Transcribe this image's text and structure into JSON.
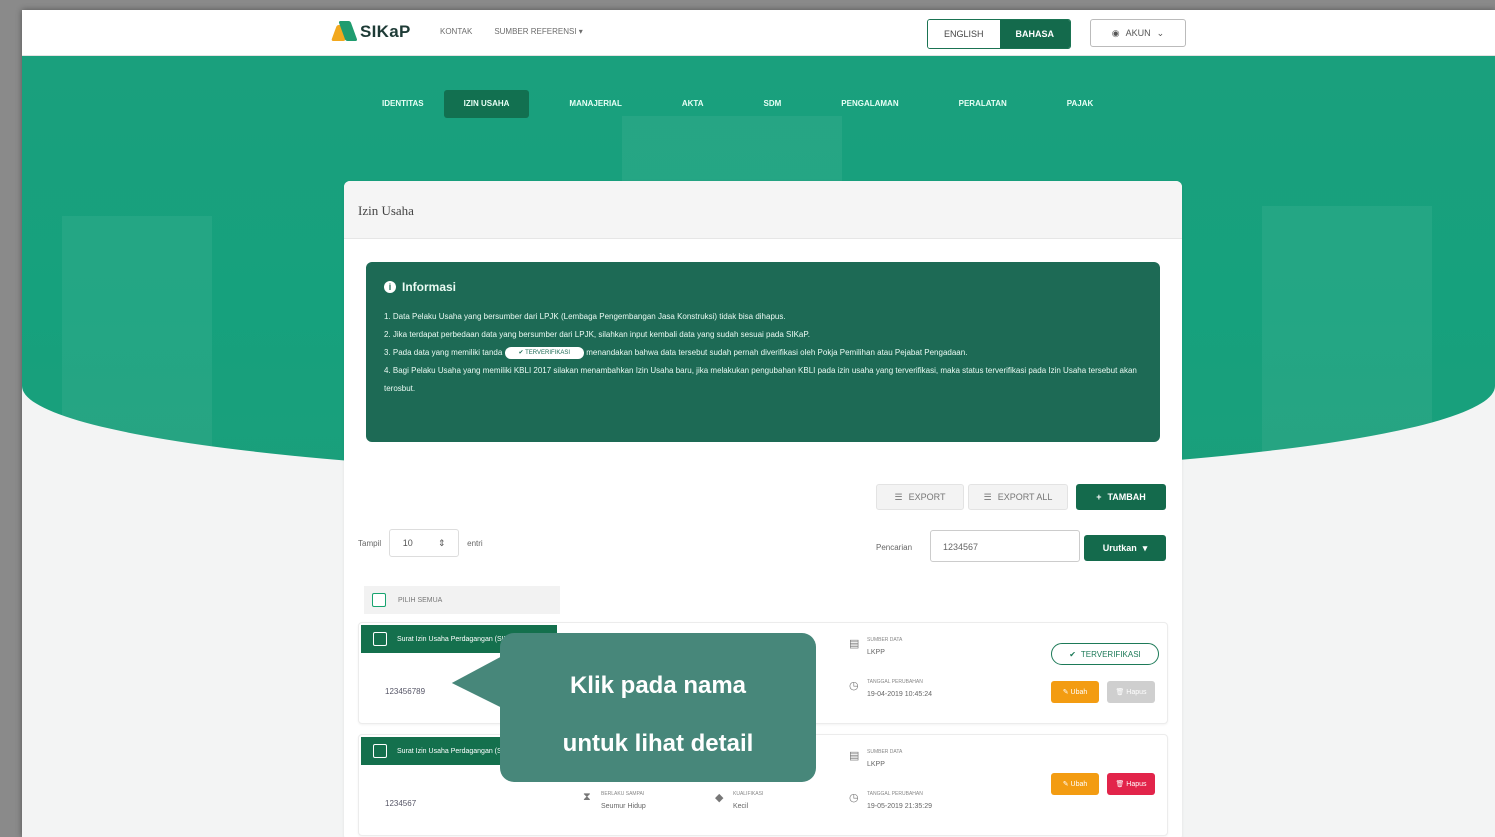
{
  "header": {
    "logo_text": "SIKaP",
    "nav": [
      "KONTAK",
      "SUMBER REFERENSI"
    ],
    "lang_en": "ENGLISH",
    "lang_id": "BAHASA",
    "akun": "AKUN"
  },
  "tabs": [
    "IDENTITAS",
    "IZIN USAHA",
    "MANAJERIAL",
    "AKTA",
    "SDM",
    "PENGALAMAN",
    "PERALATAN",
    "PAJAK"
  ],
  "active_tab": "IZIN USAHA",
  "card": {
    "title": "Izin Usaha",
    "info_title": "Informasi",
    "info_items": [
      "1. Data Pelaku Usaha yang bersumber dari LPJK (Lembaga Pengembangan Jasa Konstruksi) tidak bisa dihapus.",
      "2. Jika terdapat perbedaan data yang bersumber dari LPJK, silahkan input kembali data yang sudah sesuai pada SIKaP.",
      "3. Pada data yang memiliki tanda",
      "menandakan bahwa data tersebut sudah pernah diverifikasi oleh Pokja Pemilihan atau Pejabat Pengadaan.",
      "4. Bagi Pelaku Usaha yang memiliki KBLI 2017 silakan menambahkan Izin Usaha baru, jika melakukan pengubahan KBLI pada izin usaha yang terverifikasi, maka status terverifikasi pada Izin Usaha tersebut akan terosbut."
    ],
    "pill_label": "TERVERIFIKASI",
    "export": "EXPORT",
    "export_all": "EXPORT ALL",
    "tambah": "TAMBAH",
    "show_label": "Tampil",
    "show_value": "10",
    "show_suffix": "entri",
    "search_label": "Pencarian",
    "search_value": "1234567",
    "sort_label": "Urutkan",
    "select_all": "PILIH SEMUA"
  },
  "rows": [
    {
      "title": "Surat Izin Usaha Perdagangan (SIUP)",
      "number": "123456789",
      "sumber_label": "SUMBER DATA",
      "sumber_value": "LKPP",
      "tanggal_label": "TANGGAL PERUBAHAN",
      "tanggal_value": "19-04-2019 10:45:24",
      "verified": "TERVERIFIKASI",
      "ubah": "Ubah",
      "hapus": "Hapus"
    },
    {
      "title": "Surat Izin Usaha Perdagangan (SIUP)",
      "number": "1234567",
      "berlaku_label": "BERLAKU SAMPAI",
      "berlaku_value": "Seumur Hidup",
      "kualifikasi_label": "KUALIFIKASI",
      "kualifikasi_value": "Kecil",
      "sumber_label": "SUMBER DATA",
      "sumber_value": "LKPP",
      "tanggal_label": "TANGGAL PERUBAHAN",
      "tanggal_value": "19-05-2019 21:35:29",
      "ubah": "Ubah",
      "hapus": "Hapus"
    }
  ],
  "callout": {
    "line1": "Klik pada nama",
    "line2": "untuk lihat detail"
  },
  "colors": {
    "primary": "#146a4c",
    "hero": "#1aa07d",
    "ubah": "#f39c12",
    "hapus": "#e2244a",
    "callout": "#47877a"
  }
}
